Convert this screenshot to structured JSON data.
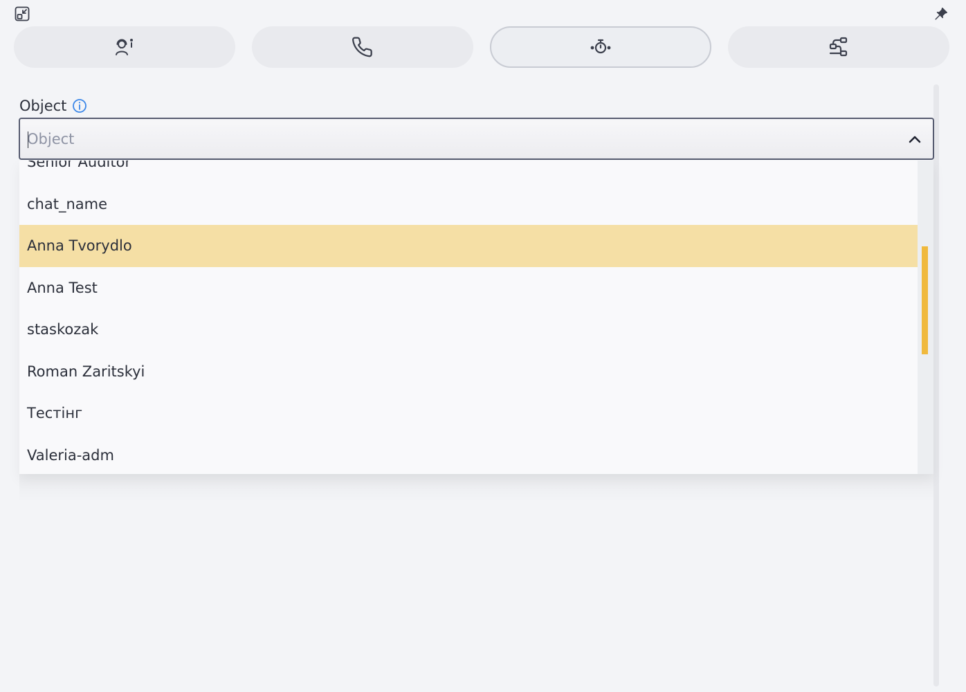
{
  "window": {
    "shrink_icon": "shrink-window-icon",
    "pin_icon": "pin-icon"
  },
  "tabs": [
    {
      "icon": "agent-info-icon",
      "active": false
    },
    {
      "icon": "phone-icon",
      "active": false
    },
    {
      "icon": "stopwatch-icon",
      "active": true
    },
    {
      "icon": "workflow-icon",
      "active": false
    }
  ],
  "field": {
    "label": "Object",
    "info_icon": "info-icon",
    "placeholder": "Object",
    "value": "",
    "chevron_icon": "chevron-up-icon"
  },
  "dropdown": {
    "options": [
      {
        "label": "Senior Auditor"
      },
      {
        "label": "chat_name"
      },
      {
        "label": "Anna Tvorydlo"
      },
      {
        "label": "Anna Test"
      },
      {
        "label": "staskozak"
      },
      {
        "label": "Roman Zaritskyi"
      },
      {
        "label": "Тестінг"
      },
      {
        "label": "Valeria-adm"
      }
    ],
    "highlighted_index": 2
  },
  "colors": {
    "accent": "#f0b93d",
    "highlight": "#f5dfa5",
    "info": "#3a86e8",
    "border": "#565b70"
  }
}
